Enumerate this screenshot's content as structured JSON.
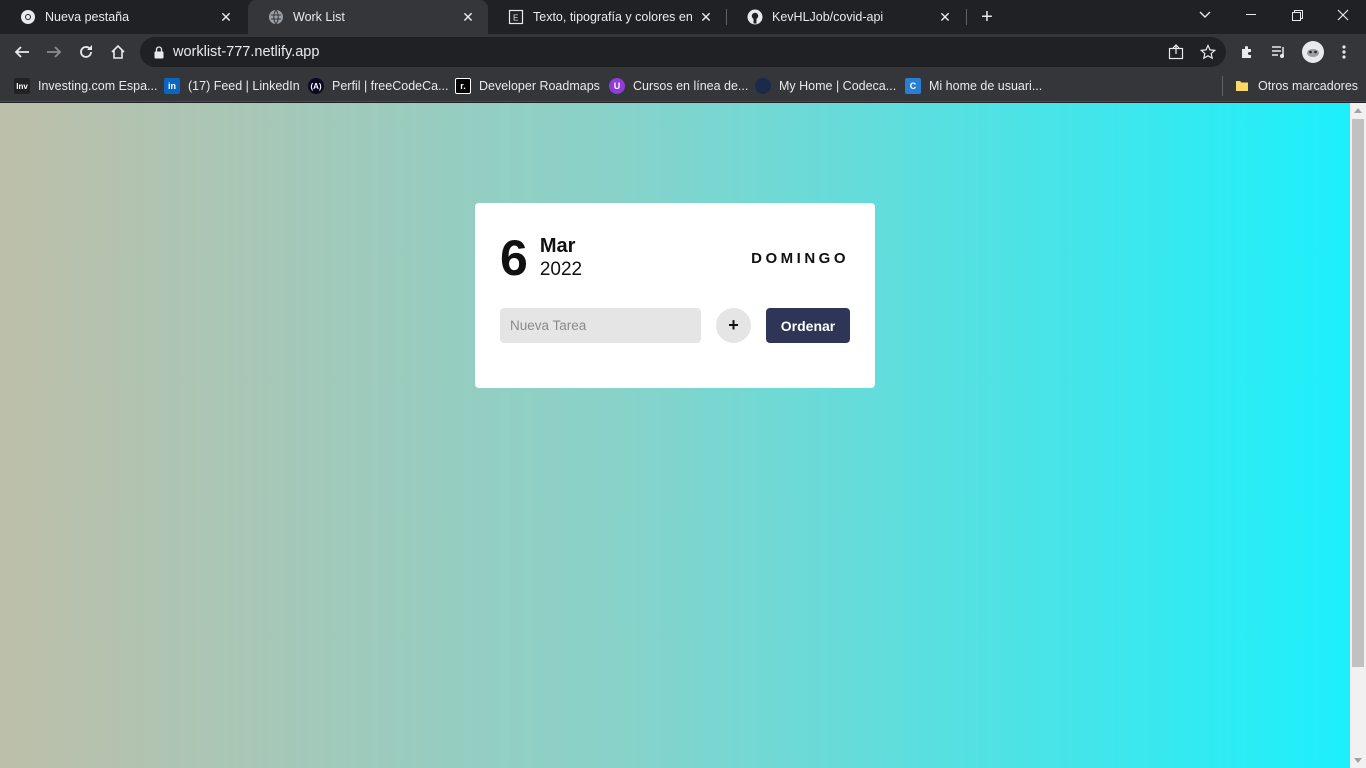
{
  "browser": {
    "tabs": [
      {
        "title": "Nueva pestaña",
        "icon": "chrome-icon",
        "active": false
      },
      {
        "title": "Work List",
        "icon": "globe-icon",
        "active": true
      },
      {
        "title": "Texto, tipografía y colores en Bootstrap",
        "icon": "page-icon",
        "active": false
      },
      {
        "title": "KevHLJob/covid-api",
        "icon": "github-icon",
        "active": false
      }
    ],
    "url": "worklist-777.netlify.app",
    "bookmarks": [
      {
        "label": "Investing.com Espa...",
        "icon_text": "Inv",
        "color": "#222222"
      },
      {
        "label": "(17) Feed | LinkedIn",
        "icon_text": "in",
        "color": "#0a66c2"
      },
      {
        "label": "Perfil | freeCodeCa...",
        "icon_text": "(A)",
        "color": "#0a0a23"
      },
      {
        "label": "Developer Roadmaps",
        "icon_text": "r.",
        "color": "#000000"
      },
      {
        "label": "Cursos en línea de...",
        "icon_text": "U",
        "color": "#8e3ddb"
      },
      {
        "label": "My Home | Codeca...",
        "icon_text": "",
        "color": "#1b2a4a"
      },
      {
        "label": "Mi home de usuari...",
        "icon_text": "C",
        "color": "#2a7ed3"
      }
    ],
    "other_bookmarks": "Otros marcadores"
  },
  "app": {
    "day": "6",
    "month": "Mar",
    "year": "2022",
    "weekday": "DOMINGO",
    "input_placeholder": "Nueva Tarea",
    "add_label": "+",
    "order_label": "Ordenar"
  },
  "colors": {
    "gradient_start": "#bdbfa9",
    "gradient_end": "#1cf0fc",
    "order_button": "#2f3556"
  }
}
